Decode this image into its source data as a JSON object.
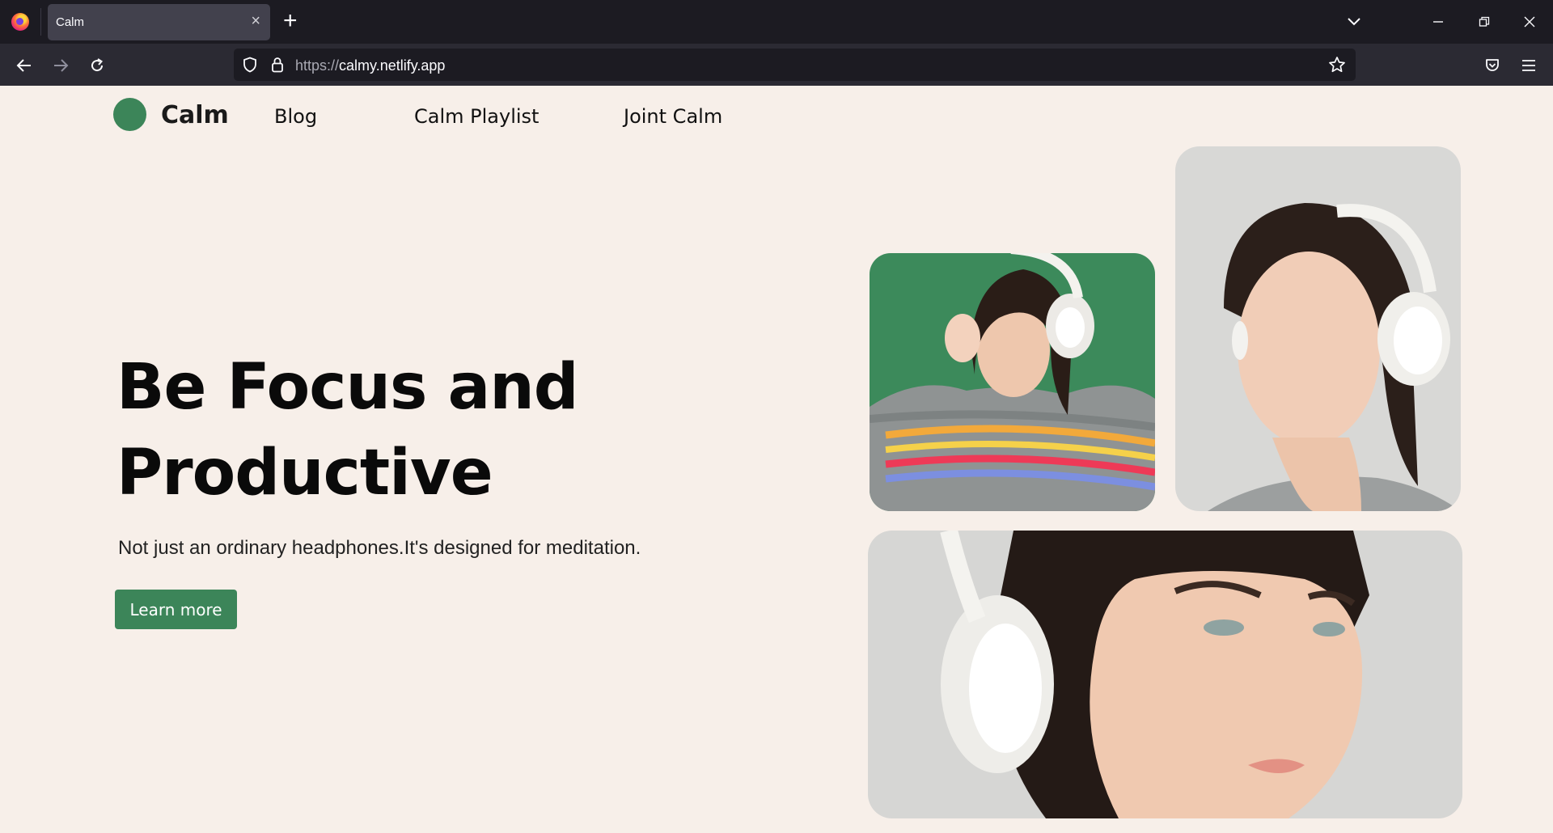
{
  "browser": {
    "tab_title": "Calm",
    "new_tab_symbol": "+",
    "close_symbol": "×",
    "url_scheme": "https://",
    "url_host": "calmy.netlify.app",
    "icons": [
      "firefox-logo",
      "list-all-tabs-icon",
      "minimize-icon",
      "restore-icon",
      "window-close-icon",
      "back-arrow-icon",
      "forward-arrow-icon",
      "reload-icon",
      "shield-icon",
      "lock-icon",
      "bookmark-star-icon",
      "pocket-icon",
      "hamburger-menu-icon"
    ]
  },
  "site": {
    "logo_text": "Calm",
    "nav": [
      {
        "label": "Blog"
      },
      {
        "label": "Calm Playlist"
      },
      {
        "label": "Joint Calm"
      }
    ],
    "hero": {
      "title_line1": "Be Focus and",
      "title_line2": "Productive",
      "subtitle": "Not just an ordinary headphones.It's designed for meditation.",
      "cta_label": "Learn more"
    },
    "colors": {
      "accent": "#3c8559",
      "background": "#f7efe9"
    }
  }
}
